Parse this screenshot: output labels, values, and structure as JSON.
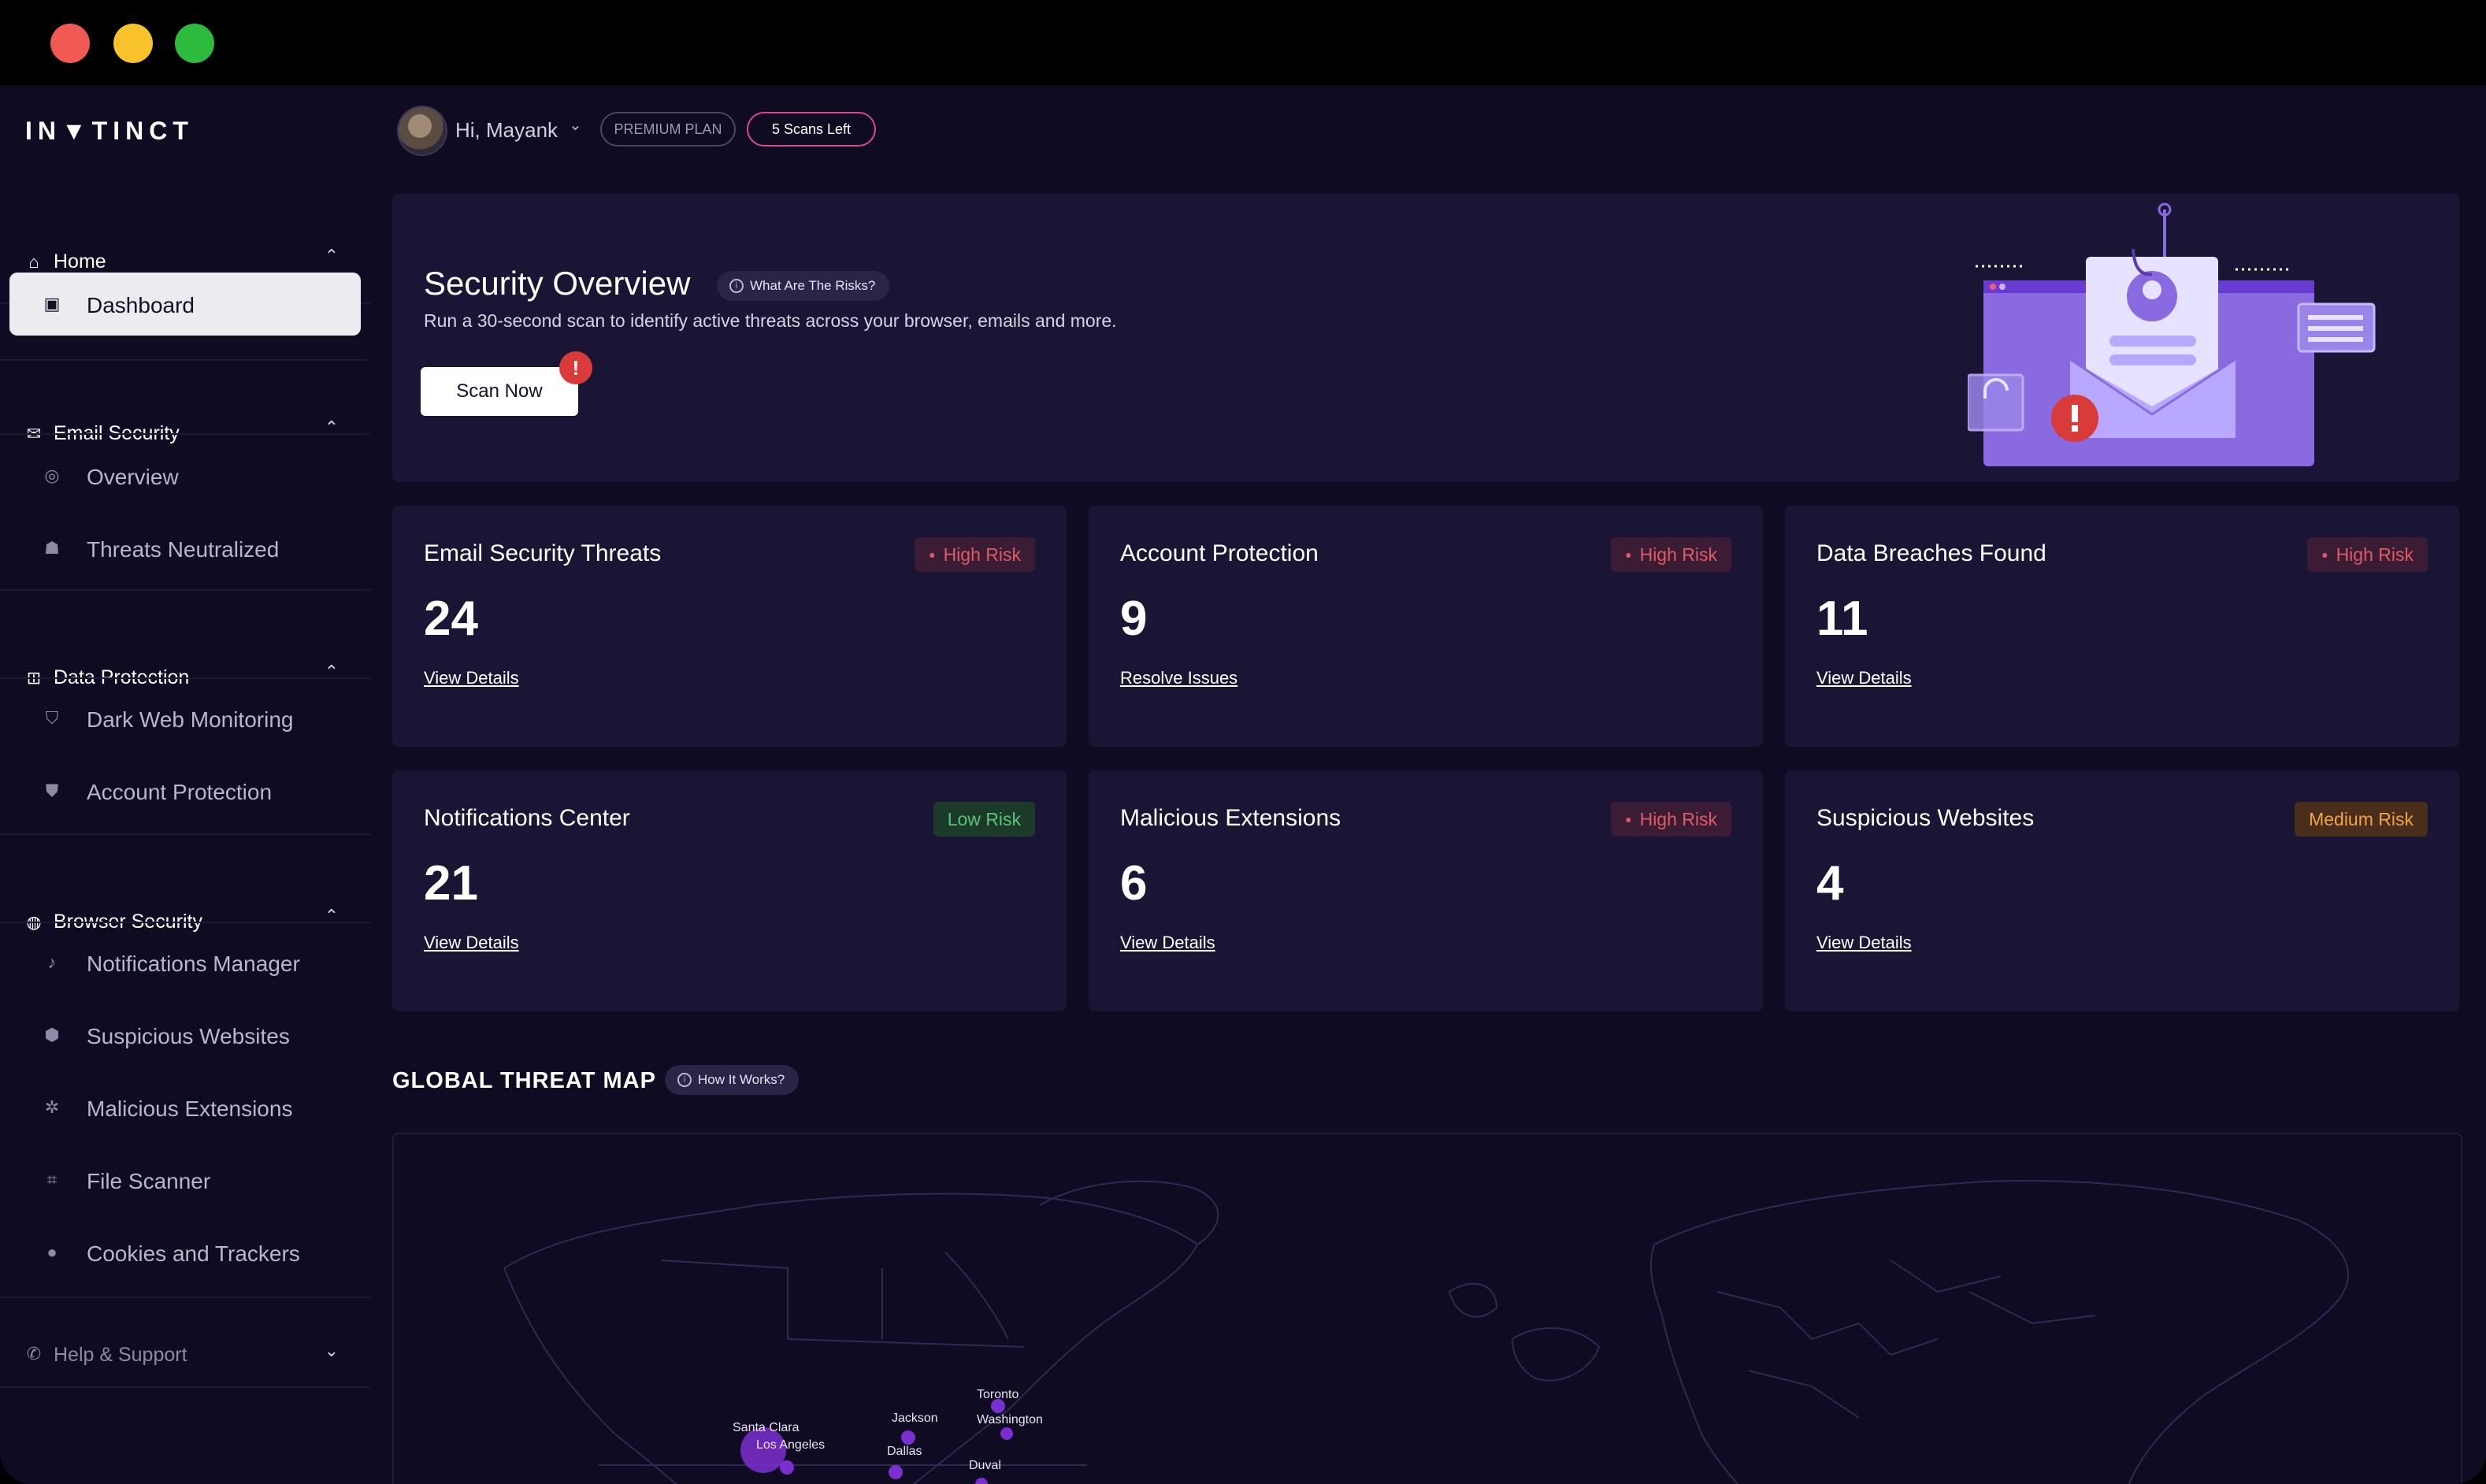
{
  "brand": {
    "name": "IN▼TINCT"
  },
  "sidebar": {
    "sections": [
      {
        "label": "Home",
        "icon": "home-icon"
      },
      {
        "label": "Email Security",
        "icon": "email-shield-icon"
      },
      {
        "label": "Data Protection",
        "icon": "database-icon"
      },
      {
        "label": "Browser Security",
        "icon": "globe-shield-icon"
      },
      {
        "label": "Help & Support",
        "icon": "phone-icon"
      }
    ],
    "items": [
      {
        "label": "Dashboard",
        "icon": "dashboard-icon"
      },
      {
        "label": "Overview",
        "icon": "overview-icon"
      },
      {
        "label": "Threats Neutralized",
        "icon": "bug-icon"
      },
      {
        "label": "Dark Web Monitoring",
        "icon": "shield-icon"
      },
      {
        "label": "Account Protection",
        "icon": "shield-user-icon"
      },
      {
        "label": "Notifications Manager",
        "icon": "bell-icon"
      },
      {
        "label": "Suspicious Websites",
        "icon": "hexagon-alert-icon"
      },
      {
        "label": "Malicious Extensions",
        "icon": "puzzle-icon"
      },
      {
        "label": "File Scanner",
        "icon": "scanner-icon"
      },
      {
        "label": "Cookies and Trackers",
        "icon": "cookie-icon"
      }
    ]
  },
  "header": {
    "greeting": "Hi, Mayank",
    "plan": "PREMIUM PLAN",
    "scans_left": "5 Scans Left"
  },
  "overview": {
    "title": "Security Overview",
    "risks_link": "What Are The Risks?",
    "description": "Run a 30-second scan to identify active threats across your browser, emails and more.",
    "scan_button": "Scan Now",
    "alert": "!"
  },
  "stats": [
    {
      "title": "Email Security Threats",
      "badge": "High Risk",
      "level": "high",
      "value": "24",
      "link": "View Details"
    },
    {
      "title": "Account Protection",
      "badge": "High Risk",
      "level": "high",
      "value": "9",
      "link": "Resolve Issues"
    },
    {
      "title": "Data Breaches Found",
      "badge": "High Risk",
      "level": "high",
      "value": "11",
      "link": "View Details"
    },
    {
      "title": "Notifications Center",
      "badge": "Low Risk",
      "level": "low",
      "value": "21",
      "link": "View Details"
    },
    {
      "title": "Malicious Extensions",
      "badge": "High Risk",
      "level": "high",
      "value": "6",
      "link": "View Details"
    },
    {
      "title": "Suspicious Websites",
      "badge": "Medium Risk",
      "level": "medium",
      "value": "4",
      "link": "View Details"
    }
  ],
  "map": {
    "title": "GLOBAL THREAT MAP",
    "how_link": "How It Works?",
    "cities": [
      "Toronto",
      "Washington",
      "Jackson",
      "Santa Clara",
      "Los Angeles",
      "Dallas",
      "Duval"
    ]
  },
  "colors": {
    "accent": "#7b2fd0",
    "high": "#e05a64",
    "low": "#58c472",
    "medium": "#f0a24a",
    "background": "#0e0b22",
    "card": "#1b1535"
  }
}
